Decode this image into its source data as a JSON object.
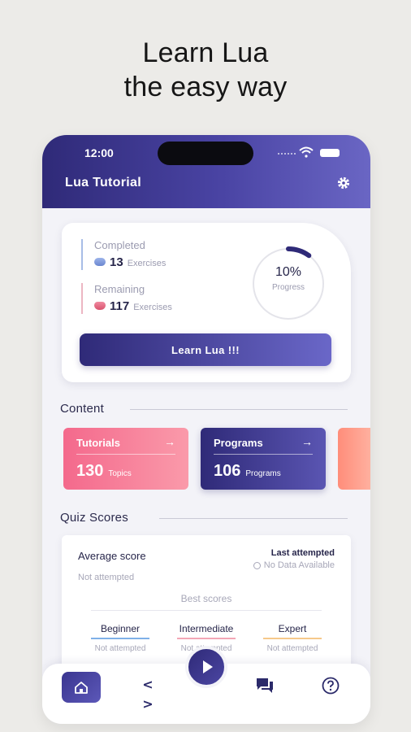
{
  "headline": {
    "line1": "Learn Lua",
    "line2": "the easy way"
  },
  "status_bar": {
    "time": "12:00"
  },
  "app_bar": {
    "title": "Lua Tutorial",
    "settings_icon": "gear-icon"
  },
  "progress": {
    "completed": {
      "label": "Completed",
      "count": "13",
      "unit": "Exercises"
    },
    "remaining": {
      "label": "Remaining",
      "count": "117",
      "unit": "Exercises"
    },
    "percent_text": "10%",
    "percent_label": "Progress",
    "percent_value": 0.1,
    "button_label": "Learn Lua !!!"
  },
  "content": {
    "title": "Content",
    "cards": [
      {
        "name": "Tutorials",
        "count": "130",
        "unit": "Topics"
      },
      {
        "name": "Programs",
        "count": "106",
        "unit": "Programs"
      }
    ]
  },
  "quiz": {
    "title": "Quiz Scores",
    "average_label": "Average score",
    "average_value": "Not attempted",
    "last_label": "Last attempted",
    "last_value": "No Data Available",
    "best_label": "Best scores",
    "levels": [
      {
        "name": "Beginner",
        "value": "Not attempted",
        "color": "#7fb0e8"
      },
      {
        "name": "Intermediate",
        "value": "Not attempted",
        "color": "#f3a6b6"
      },
      {
        "name": "Expert",
        "value": "Not attempted",
        "color": "#f6c98a"
      }
    ]
  },
  "colors": {
    "primary": "#2f2a78",
    "accent": "#f4698c"
  }
}
